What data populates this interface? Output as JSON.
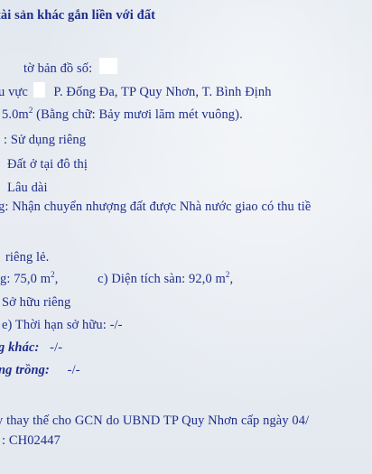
{
  "heading": "tài sản khác gắn liền với đất",
  "map_sheet": {
    "label": "tờ bản đồ số:"
  },
  "area_location": {
    "label": "u vực",
    "value": "P. Đống Đa, TP Quy Nhơn, T. Bình Định"
  },
  "land_area": {
    "number": "5.0m",
    "sup": "2",
    "in_words": "(Bằng chữ: Bảy mươi lăm mét vuông)."
  },
  "use_form": ": Sử dụng riêng",
  "land_purpose": "Đất ở tại đô thị",
  "use_term": "Lâu dài",
  "use_origin": "g: Nhận chuyển nhượng đất được Nhà nước giao có thu tiề",
  "house_type": "riêng lẻ.",
  "construction_area": {
    "label": "g: 75,0 m",
    "sup": "2",
    "suffix": ","
  },
  "floor_area": {
    "label": "c) Diện tích sàn: 92,0 m",
    "sup": "2",
    "suffix": ","
  },
  "ownership_form": "Sở hữu riêng",
  "ownership_term": "e) Thời hạn sở hữu: -/-",
  "other_construction": {
    "label": "g khác:",
    "value": "-/-"
  },
  "perennial_trees": {
    "label": "ng trồng:",
    "value": "-/-"
  },
  "replacement_note": "y thay thế cho GCN do UBND TP Quy Nhơn cấp ngày 04/",
  "cert_number": ": CH02447"
}
